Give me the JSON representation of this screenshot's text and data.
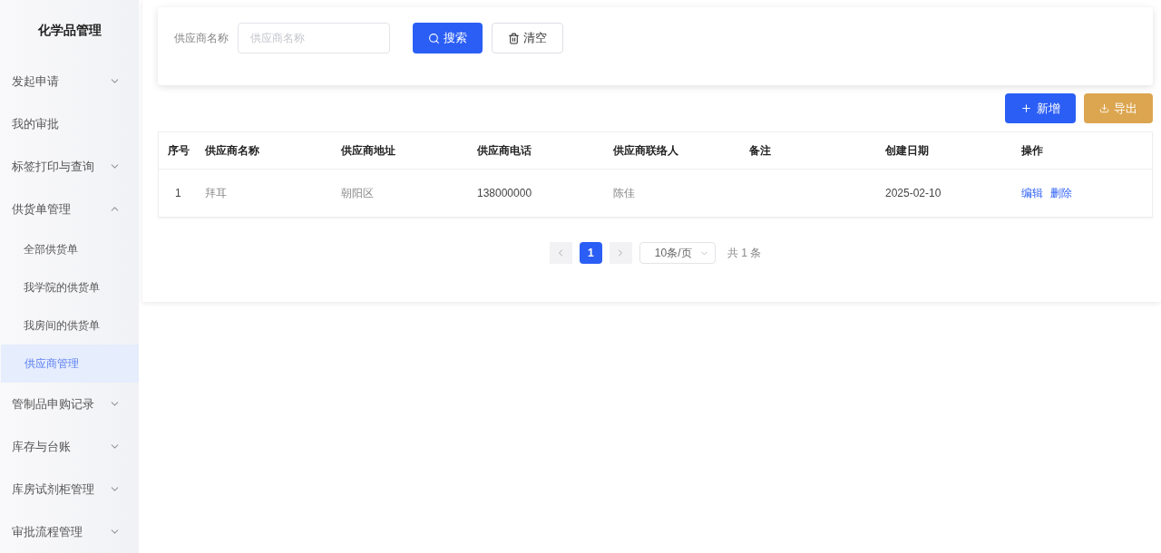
{
  "sidebar": {
    "title": "化学品管理",
    "items": [
      {
        "label": "发起申请",
        "kind": "group",
        "expanded": false
      },
      {
        "label": "我的审批",
        "kind": "link"
      },
      {
        "label": "标签打印与查询",
        "kind": "group",
        "expanded": false
      },
      {
        "label": "供货单管理",
        "kind": "group",
        "expanded": true,
        "children": [
          {
            "label": "全部供货单",
            "selected": false
          },
          {
            "label": "我学院的供货单",
            "selected": false
          },
          {
            "label": "我房间的供货单",
            "selected": false
          },
          {
            "label": "供应商管理",
            "selected": true
          }
        ]
      },
      {
        "label": "管制品申购记录",
        "kind": "group",
        "expanded": false
      },
      {
        "label": "库存与台账",
        "kind": "group",
        "expanded": false
      },
      {
        "label": "库房试剂柜管理",
        "kind": "group",
        "expanded": false
      },
      {
        "label": "审批流程管理",
        "kind": "group",
        "expanded": false
      }
    ]
  },
  "search": {
    "label": "供应商名称",
    "placeholder": "供应商名称",
    "buttons": [
      {
        "label": "搜索",
        "kind": "primary"
      },
      {
        "label": "清空",
        "kind": "default"
      }
    ]
  },
  "toolbar": [
    {
      "label": "新增",
      "kind": "add"
    },
    {
      "label": "导出",
      "kind": "export"
    }
  ],
  "table": {
    "columns": [
      "序号",
      "供应商名称",
      "供应商地址",
      "供应商电话",
      "供应商联络人",
      "备注",
      "创建日期",
      "操作"
    ],
    "rows": [
      {
        "index": "1",
        "name": "拜耳",
        "address": "朝阳区",
        "phone": "138000000",
        "contact": "陈佳",
        "created": "2025-02-10",
        "actions": [
          "编辑",
          "删除"
        ]
      }
    ]
  },
  "pagination": {
    "pages": [
      {
        "label": "1",
        "selected": true
      }
    ],
    "page_size": "10条/页",
    "total": "共 1 条"
  }
}
